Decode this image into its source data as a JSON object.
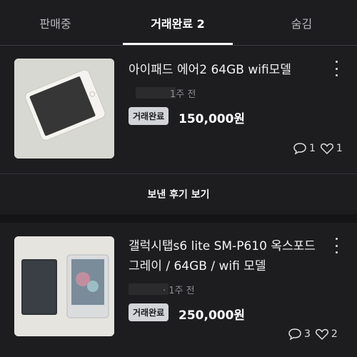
{
  "tabs": [
    {
      "label": "판매중"
    },
    {
      "label": "거래완료 2"
    },
    {
      "label": "숨김"
    }
  ],
  "items": [
    {
      "title": "아이패드 에어2 64GB wifi모델",
      "time": "1주 전",
      "status": "거래완료",
      "price": "150,000원",
      "chats": "1",
      "likes": "1"
    },
    {
      "title": "갤럭시탭s6 lite SM-P610 옥스포드 그레이 / 64GB / wifi 모델",
      "time": "· 1주 전",
      "status": "거래완료",
      "price": "250,000원",
      "chats": "3",
      "likes": "2"
    }
  ],
  "review_button": "보낸 후기 보기",
  "icons": [
    "kebab-menu-icon",
    "chat-bubble-icon",
    "heart-icon"
  ],
  "colors": {
    "background": "#1d1d20",
    "badge": "#d3d4d8",
    "text": "#ececec"
  }
}
